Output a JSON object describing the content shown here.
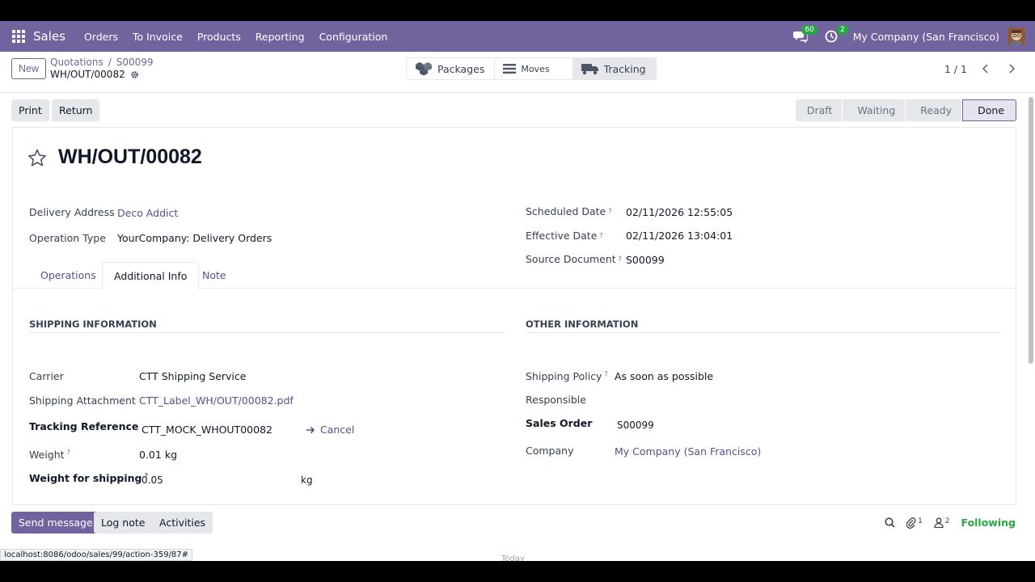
{
  "navbar": {
    "brand": "Sales",
    "menu": [
      "Orders",
      "To Invoice",
      "Products",
      "Reporting",
      "Configuration"
    ],
    "messages_count": "60",
    "activities_count": "2",
    "company": "My Company (San Francisco)"
  },
  "control": {
    "new_label": "New",
    "breadcrumb": [
      "Quotations",
      "S00099"
    ],
    "current": "WH/OUT/00082",
    "smart_buttons": [
      {
        "label": "Packages",
        "icon": "boxes-icon"
      },
      {
        "label": "Moves",
        "icon": "list-icon"
      },
      {
        "label": "Tracking",
        "icon": "truck-icon"
      }
    ],
    "pager": "1 / 1"
  },
  "actions": {
    "print": "Print",
    "return": "Return",
    "stages": [
      "Draft",
      "Waiting",
      "Ready",
      "Done"
    ],
    "active_stage": "Done"
  },
  "form": {
    "title": "WH/OUT/00082",
    "delivery_address_label": "Delivery Address",
    "delivery_address": "Deco Addict",
    "operation_type_label": "Operation Type",
    "operation_type": "YourCompany: Delivery Orders",
    "scheduled_date_label": "Scheduled Date",
    "scheduled_date": "02/11/2026 12:55:05",
    "effective_date_label": "Effective Date",
    "effective_date": "02/11/2026 13:04:01",
    "source_document_label": "Source Document",
    "source_document": "S00099",
    "help_mark": "?"
  },
  "tabs": [
    "Operations",
    "Additional Info",
    "Note"
  ],
  "shipping": {
    "title": "SHIPPING INFORMATION",
    "carrier_label": "Carrier",
    "carrier": "CTT Shipping Service",
    "attachment_label": "Shipping Attachment",
    "attachment": "CTT_Label_WH/OUT/00082.pdf",
    "tracking_label": "Tracking Reference",
    "tracking": "CTT_MOCK_WHOUT00082",
    "cancel": "Cancel",
    "weight_label": "Weight",
    "weight": "0.01",
    "weight_unit": "kg",
    "ship_weight_label": "Weight for shipping",
    "ship_weight": "0.05",
    "ship_weight_unit": "kg"
  },
  "other": {
    "title": "OTHER INFORMATION",
    "policy_label": "Shipping Policy",
    "policy": "As soon as possible",
    "responsible_label": "Responsible",
    "sales_order_label": "Sales Order",
    "sales_order": "S00099",
    "company_label": "Company",
    "company": "My Company (San Francisco)"
  },
  "chatter": {
    "send": "Send message",
    "log": "Log note",
    "activities": "Activities",
    "attachments_count": "1",
    "followers_count": "2",
    "following": "Following",
    "today": "Today"
  },
  "statusline": "localhost:8086/odoo/sales/99/action-359/87#",
  "colors": {
    "brand": "#71639e",
    "following": "#28a745"
  }
}
